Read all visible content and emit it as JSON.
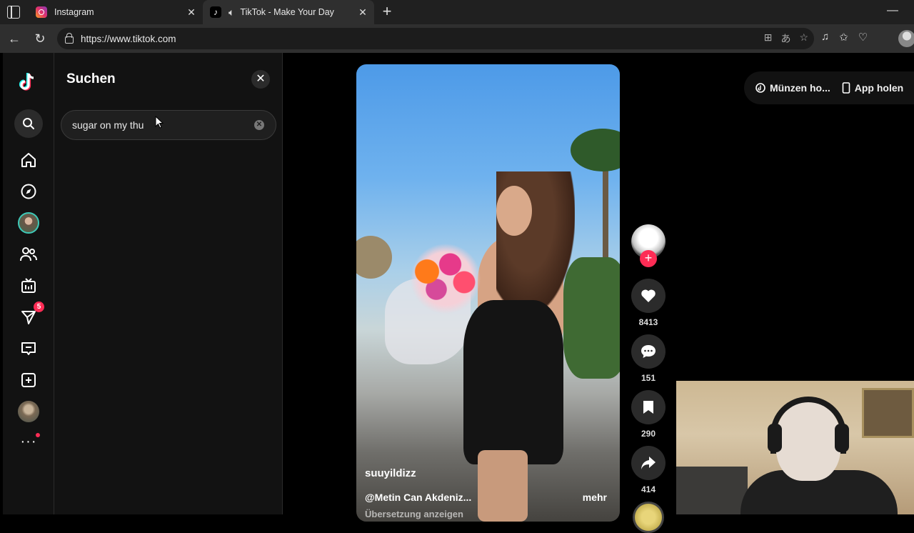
{
  "browser": {
    "tabs": [
      {
        "title": "Instagram",
        "active": false
      },
      {
        "title": "TikTok - Make Your Day",
        "active": true
      }
    ],
    "url": "https://www.tiktok.com"
  },
  "sidebar": {
    "message_badge": "5"
  },
  "search_panel": {
    "title": "Suchen",
    "query": "sugar on my thu"
  },
  "top_buttons": {
    "coins": "Münzen ho...",
    "app": "App holen"
  },
  "video": {
    "username": "suuyildizz",
    "caption": "@Metin Can Akdeniz...",
    "more": "mehr",
    "translate": "Übersetzung anzeigen"
  },
  "actions": {
    "likes": "8413",
    "comments": "151",
    "saves": "290",
    "shares": "414"
  },
  "colors": {
    "accent": "#fe2c55",
    "panel": "#121212"
  }
}
